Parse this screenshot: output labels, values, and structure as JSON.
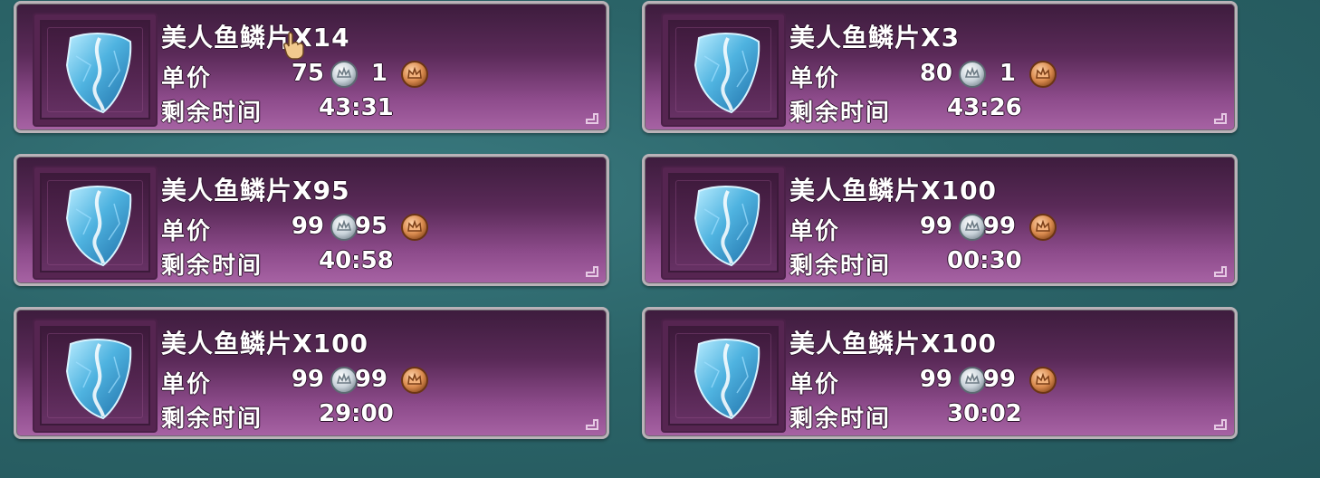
{
  "listings": [
    {
      "title": "美人鱼鳞片X14",
      "price_label": "单价",
      "silver": "75",
      "gold": "1",
      "time_label": "剩余时间",
      "time": "43:31"
    },
    {
      "title": "美人鱼鳞片X3",
      "price_label": "单价",
      "silver": "80",
      "gold": "1",
      "time_label": "剩余时间",
      "time": "43:26"
    },
    {
      "title": "美人鱼鳞片X95",
      "price_label": "单价",
      "silver": "99",
      "gold": "95",
      "time_label": "剩余时间",
      "time": "40:58"
    },
    {
      "title": "美人鱼鳞片X100",
      "price_label": "单价",
      "silver": "99",
      "gold": "99",
      "time_label": "剩余时间",
      "time": "00:30"
    },
    {
      "title": "美人鱼鳞片X100",
      "price_label": "单价",
      "silver": "99",
      "gold": "99",
      "time_label": "剩余时间",
      "time": "29:00"
    },
    {
      "title": "美人鱼鳞片X100",
      "price_label": "单价",
      "silver": "99",
      "gold": "99",
      "time_label": "剩余时间",
      "time": "30:02"
    }
  ],
  "icons": {
    "item": "mermaid-scale-icon",
    "silver": "silver-coin-icon",
    "gold": "bronze-crown-coin-icon",
    "corner": "corner-marker-icon",
    "cursor": "hand-cursor-icon"
  },
  "colors": {
    "card_top": "#3d1c3d",
    "card_bottom": "#a763a4",
    "card_border": "#b9b2b8",
    "background": "#2b6468",
    "scale": "#4fb3e0",
    "silver": "#c9d3da",
    "bronze": "#d98a4e"
  }
}
